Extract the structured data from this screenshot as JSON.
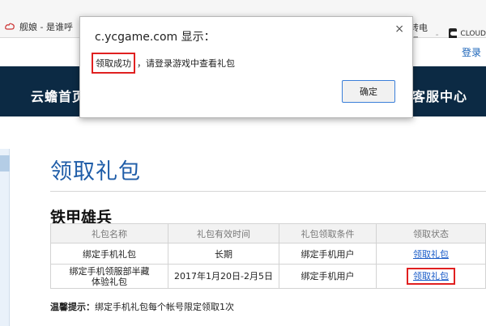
{
  "browser": {
    "tab_left_text": "舰娘 - 是谁呼",
    "tab_right_text": "转电玩",
    "tab_right_dash": "-",
    "tab_right_badge": "CLOUD"
  },
  "header": {
    "login_label": "登录",
    "nav_home": "云蟾首页",
    "nav_service": "客服中心"
  },
  "page": {
    "title": "领取礼包",
    "game_name": "铁甲雄兵"
  },
  "table": {
    "headers": [
      "礼包名称",
      "礼包有效时间",
      "礼包领取条件",
      "领取状态"
    ],
    "rows": [
      {
        "name": "绑定手机礼包",
        "time": "长期",
        "condition": "绑定手机用户",
        "status": "领取礼包"
      },
      {
        "name_line1": "绑定手机领服部半藏",
        "name_line2": "体验礼包",
        "time": "2017年1月20日-2月5日",
        "condition": "绑定手机用户",
        "status": "领取礼包"
      }
    ]
  },
  "tip": {
    "label": "温馨提示：",
    "text": "绑定手机礼包每个帐号限定领取1次"
  },
  "dialog": {
    "title": "c.ycgame.com 显示：",
    "message_highlight": "领取成功",
    "message_rest": "，请登录游戏中查看礼包",
    "ok_label": "确定",
    "close_glyph": "×"
  },
  "colors": {
    "navbar": "#0c2a44",
    "title_blue": "#1f5da8",
    "link_blue": "#1a5cc8",
    "highlight_red": "#e02020"
  }
}
